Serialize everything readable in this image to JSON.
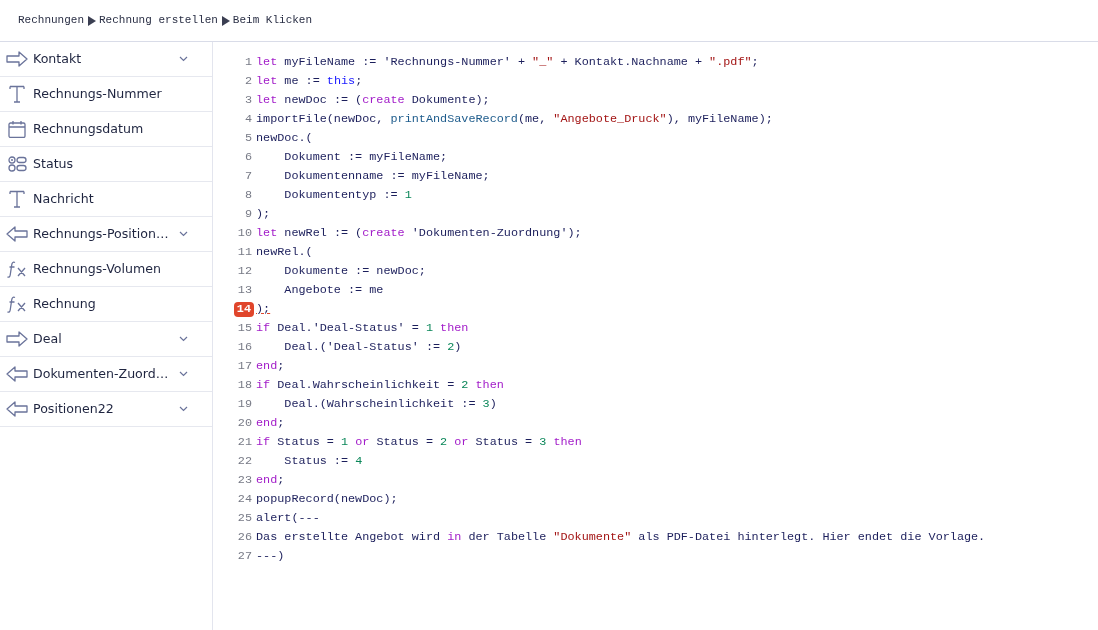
{
  "breadcrumb": [
    "Rechnungen",
    "Rechnung erstellen",
    "Beim Klicken"
  ],
  "sidebar": {
    "items": [
      {
        "kind": "link-out",
        "label": "Kontakt",
        "expandable": true
      },
      {
        "kind": "text",
        "label": "Rechnungs-Nummer",
        "expandable": false
      },
      {
        "kind": "date",
        "label": "Rechnungsdatum",
        "expandable": false
      },
      {
        "kind": "choice",
        "label": "Status",
        "expandable": false
      },
      {
        "kind": "text",
        "label": "Nachricht",
        "expandable": false
      },
      {
        "kind": "link-in",
        "label": "Rechnungs-Position…",
        "expandable": true
      },
      {
        "kind": "formula",
        "label": "Rechnungs-Volumen",
        "expandable": false
      },
      {
        "kind": "formula",
        "label": "Rechnung",
        "expandable": false
      },
      {
        "kind": "link-out",
        "label": "Deal",
        "expandable": true
      },
      {
        "kind": "link-in",
        "label": "Dokumenten-Zuord…",
        "expandable": true
      },
      {
        "kind": "link-in",
        "label": "Positionen22",
        "expandable": true
      }
    ]
  },
  "editor": {
    "lines": [
      {
        "number": "1",
        "error": false,
        "tokens": [
          {
            "kind": "keyword",
            "text": "let"
          },
          {
            "kind": "plain",
            "text": " myFileName := 'Rechnungs-Nummer' + "
          },
          {
            "kind": "string",
            "text": "\"_\""
          },
          {
            "kind": "plain",
            "text": " + Kontakt.Nachname + "
          },
          {
            "kind": "string",
            "text": "\".pdf\""
          },
          {
            "kind": "plain",
            "text": ";"
          }
        ]
      },
      {
        "number": "2",
        "error": false,
        "tokens": [
          {
            "kind": "keyword",
            "text": "let"
          },
          {
            "kind": "plain",
            "text": " me := "
          },
          {
            "kind": "self",
            "text": "this"
          },
          {
            "kind": "plain",
            "text": ";"
          }
        ]
      },
      {
        "number": "3",
        "error": false,
        "tokens": [
          {
            "kind": "keyword",
            "text": "let"
          },
          {
            "kind": "plain",
            "text": " newDoc := ("
          },
          {
            "kind": "keyword",
            "text": "create"
          },
          {
            "kind": "plain",
            "text": " Dokumente);"
          }
        ]
      },
      {
        "number": "4",
        "error": false,
        "tokens": [
          {
            "kind": "plain",
            "text": "importFile(newDoc, "
          },
          {
            "kind": "function",
            "text": "printAndSaveRecord"
          },
          {
            "kind": "plain",
            "text": "(me, "
          },
          {
            "kind": "string",
            "text": "\"Angebote_Druck\""
          },
          {
            "kind": "plain",
            "text": "), myFileName);"
          }
        ]
      },
      {
        "number": "5",
        "error": false,
        "tokens": [
          {
            "kind": "plain",
            "text": "newDoc.("
          }
        ]
      },
      {
        "number": "6",
        "error": false,
        "tokens": [
          {
            "kind": "plain",
            "text": "    Dokument := myFileName;"
          }
        ]
      },
      {
        "number": "7",
        "error": false,
        "tokens": [
          {
            "kind": "plain",
            "text": "    Dokumentenname := myFileName;"
          }
        ]
      },
      {
        "number": "8",
        "error": false,
        "tokens": [
          {
            "kind": "plain",
            "text": "    Dokumententyp := "
          },
          {
            "kind": "number",
            "text": "1"
          }
        ]
      },
      {
        "number": "9",
        "error": false,
        "tokens": [
          {
            "kind": "plain",
            "text": ");"
          }
        ]
      },
      {
        "number": "10",
        "error": false,
        "tokens": [
          {
            "kind": "keyword",
            "text": "let"
          },
          {
            "kind": "plain",
            "text": " newRel := ("
          },
          {
            "kind": "keyword",
            "text": "create"
          },
          {
            "kind": "plain",
            "text": " 'Dokumenten-Zuordnung');"
          }
        ]
      },
      {
        "number": "11",
        "error": false,
        "tokens": [
          {
            "kind": "plain",
            "text": "newRel.("
          }
        ]
      },
      {
        "number": "12",
        "error": false,
        "tokens": [
          {
            "kind": "plain",
            "text": "    Dokumente := newDoc;"
          }
        ]
      },
      {
        "number": "13",
        "error": false,
        "tokens": [
          {
            "kind": "plain",
            "text": "    Angebote := me"
          }
        ]
      },
      {
        "number": "14",
        "error": true,
        "tokens": [
          {
            "kind": "plain",
            "text": ");"
          }
        ]
      },
      {
        "number": "15",
        "error": false,
        "tokens": [
          {
            "kind": "keyword",
            "text": "if"
          },
          {
            "kind": "plain",
            "text": " Deal.'Deal-Status' = "
          },
          {
            "kind": "number",
            "text": "1"
          },
          {
            "kind": "keyword",
            "text": " then"
          }
        ]
      },
      {
        "number": "16",
        "error": false,
        "tokens": [
          {
            "kind": "plain",
            "text": "    Deal.('Deal-Status' := "
          },
          {
            "kind": "number",
            "text": "2"
          },
          {
            "kind": "plain",
            "text": ")"
          }
        ]
      },
      {
        "number": "17",
        "error": false,
        "tokens": [
          {
            "kind": "keyword",
            "text": "end"
          },
          {
            "kind": "plain",
            "text": ";"
          }
        ]
      },
      {
        "number": "18",
        "error": false,
        "tokens": [
          {
            "kind": "keyword",
            "text": "if"
          },
          {
            "kind": "plain",
            "text": " Deal.Wahrscheinlichkeit = "
          },
          {
            "kind": "number",
            "text": "2"
          },
          {
            "kind": "keyword",
            "text": " then"
          }
        ]
      },
      {
        "number": "19",
        "error": false,
        "tokens": [
          {
            "kind": "plain",
            "text": "    Deal.(Wahrscheinlichkeit := "
          },
          {
            "kind": "number",
            "text": "3"
          },
          {
            "kind": "plain",
            "text": ")"
          }
        ]
      },
      {
        "number": "20",
        "error": false,
        "tokens": [
          {
            "kind": "keyword",
            "text": "end"
          },
          {
            "kind": "plain",
            "text": ";"
          }
        ]
      },
      {
        "number": "21",
        "error": false,
        "tokens": [
          {
            "kind": "keyword",
            "text": "if"
          },
          {
            "kind": "plain",
            "text": " Status = "
          },
          {
            "kind": "number",
            "text": "1"
          },
          {
            "kind": "keyword",
            "text": " or"
          },
          {
            "kind": "plain",
            "text": " Status = "
          },
          {
            "kind": "number",
            "text": "2"
          },
          {
            "kind": "keyword",
            "text": " or"
          },
          {
            "kind": "plain",
            "text": " Status = "
          },
          {
            "kind": "number",
            "text": "3"
          },
          {
            "kind": "keyword",
            "text": " then"
          }
        ]
      },
      {
        "number": "22",
        "error": false,
        "tokens": [
          {
            "kind": "plain",
            "text": "    Status := "
          },
          {
            "kind": "number",
            "text": "4"
          }
        ]
      },
      {
        "number": "23",
        "error": false,
        "tokens": [
          {
            "kind": "keyword",
            "text": "end"
          },
          {
            "kind": "plain",
            "text": ";"
          }
        ]
      },
      {
        "number": "24",
        "error": false,
        "tokens": [
          {
            "kind": "plain",
            "text": "popupRecord(newDoc);"
          }
        ]
      },
      {
        "number": "25",
        "error": false,
        "tokens": [
          {
            "kind": "plain",
            "text": "alert(---"
          }
        ]
      },
      {
        "number": "26",
        "error": false,
        "tokens": [
          {
            "kind": "plain",
            "text": "Das erstellte Angebot wird "
          },
          {
            "kind": "keyword",
            "text": "in"
          },
          {
            "kind": "plain",
            "text": " der Tabelle "
          },
          {
            "kind": "string",
            "text": "\"Dokumente\""
          },
          {
            "kind": "plain",
            "text": " als PDF-Datei hinterlegt. Hier endet die Vorlage."
          }
        ]
      },
      {
        "number": "27",
        "error": false,
        "tokens": [
          {
            "kind": "plain",
            "text": "---)"
          }
        ]
      }
    ]
  }
}
